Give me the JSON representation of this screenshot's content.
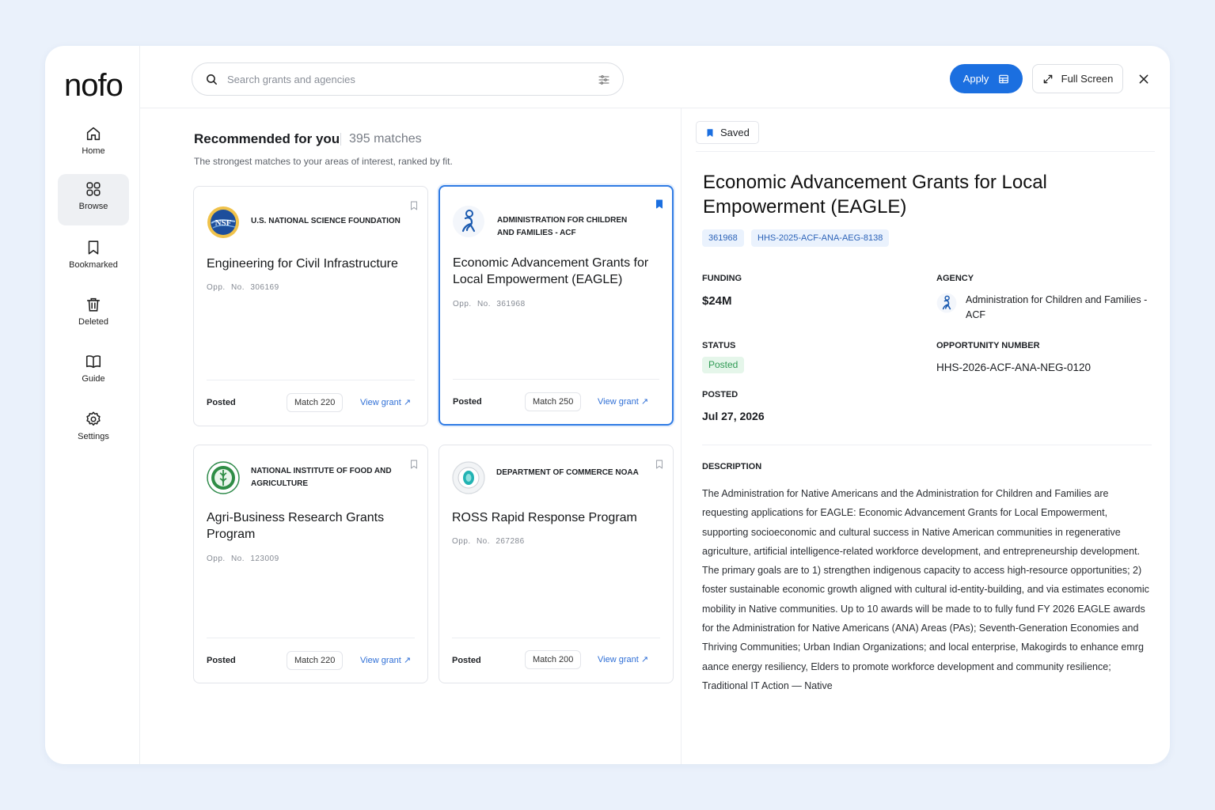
{
  "app": {
    "logo": "nofo"
  },
  "sidebar": {
    "items": [
      {
        "label": "Home",
        "icon": "home-icon"
      },
      {
        "label": "Browse",
        "icon": "grid-icon",
        "active": true
      },
      {
        "label": "Bookmarked",
        "icon": "bookmark-icon"
      },
      {
        "label": "Deleted",
        "icon": "trash-icon"
      },
      {
        "label": "Guide",
        "icon": "book-icon"
      },
      {
        "label": "Settings",
        "icon": "gear-icon"
      }
    ]
  },
  "topbar": {
    "search_placeholder": "Search grants and agencies",
    "apply_label": "Apply",
    "fullscreen_label": "Full Screen"
  },
  "recommendations": {
    "title": "Recommended for you",
    "count": "395 matches",
    "subtitle": "The strongest matches to your areas of interest, ranked by fit.",
    "cards": [
      {
        "agency": "U.S. NATIONAL SCIENCE FOUNDATION",
        "title": "Engineering for Civil Infrastructure",
        "opp_label": "Opp. No.",
        "opp_no": "306169",
        "status": "Posted",
        "match": "Match 220",
        "view": "View grant",
        "bookmarked": false
      },
      {
        "agency": "ADMINISTRATION FOR CHILDREN AND FAMILIES - ACF",
        "title": "Economic Advancement Grants for Local Empowerment (EAGLE)",
        "opp_label": "Opp. No.",
        "opp_no": "361968",
        "status": "Posted",
        "match": "Match 250",
        "view": "View grant",
        "bookmarked": true
      },
      {
        "agency": "NATIONAL INSTITUTE OF FOOD AND AGRICULTURE",
        "title": "Agri-Business Research Grants Program",
        "opp_label": "Opp. No.",
        "opp_no": "123009",
        "status": "Posted",
        "match": "Match 220",
        "view": "View grant",
        "bookmarked": false
      },
      {
        "agency": "DEPARTMENT OF COMMERCE NOAA",
        "title": "ROSS Rapid Response Program",
        "opp_label": "Opp. No.",
        "opp_no": "267286",
        "status": "Posted",
        "match": "Match 200",
        "view": "View grant",
        "bookmarked": false
      }
    ]
  },
  "detail": {
    "saved_label": "Saved",
    "title": "Economic Advancement Grants for Local Empowerment (EAGLE)",
    "chips": [
      "361968",
      "HHS-2025-ACF-ANA-AEG-8138"
    ],
    "funding_label": "FUNDING",
    "funding": "$24M",
    "agency_label": "AGENCY",
    "agency": "Administration for Children and Families - ACF",
    "status_label": "STATUS",
    "status": "Posted",
    "opp_number_label": "OPPORTUNITY NUMBER",
    "opp_number": "HHS-2026-ACF-ANA-NEG-0120",
    "posted_label": "POSTED",
    "posted": "Jul 27, 2026",
    "description_label": "DESCRIPTION",
    "description": "The Administration for Native Americans and the Administration for Children and Families are requesting applications for EAGLE: Economic Advancement Grants for Local Empowerment, supporting socioeconomic and cultural success in Native American communities in regenerative agriculture, artificial intelligence-related workforce development, and entrepreneurship development. The primary goals are to 1) strengthen indigenous capacity to access high-resource opportunities; 2) foster sustainable economic growth aligned with cultural id-entity-building, and via estimates economic mobility in Native communities. Up to 10 awards will be made to to fully fund FY 2026 EAGLE awards for the Administration for Native Americans (ANA) Areas (PAs); Seventh-Generation Economies and Thriving Communities; Urban Indian Organizations; and local enterprise, Makogirds to enhance emrg aance energy resiliency, Elders to promote workforce development and community resilience; Traditional IT Action — Native"
  },
  "colors": {
    "accent": "#1b6fe0",
    "posted_green": "#2e9a53",
    "chip_bg": "#eaf2fd"
  }
}
